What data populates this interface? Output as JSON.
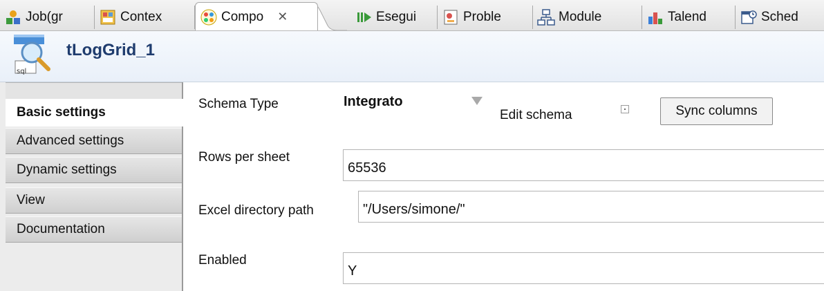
{
  "tabs": [
    {
      "label": "Job(gr",
      "icon": "job-icon",
      "active": false
    },
    {
      "label": "Contex",
      "icon": "context-icon",
      "active": false
    },
    {
      "label": "Compo",
      "icon": "component-icon",
      "active": true,
      "close": "✕"
    },
    {
      "label": "Esegui",
      "icon": "run-icon",
      "active": false
    },
    {
      "label": "Proble",
      "icon": "problems-icon",
      "active": false
    },
    {
      "label": "Module",
      "icon": "modules-icon",
      "active": false
    },
    {
      "label": "Talend",
      "icon": "talend-icon",
      "active": false
    },
    {
      "label": "Sched",
      "icon": "scheduler-icon",
      "active": false
    }
  ],
  "header": {
    "title": "tLogGrid_1",
    "icon": "tloggrid-component-icon"
  },
  "nav": {
    "items": [
      {
        "label": "Basic settings",
        "active": true
      },
      {
        "label": "Advanced settings",
        "active": false
      },
      {
        "label": "Dynamic settings",
        "active": false
      },
      {
        "label": "View",
        "active": false
      },
      {
        "label": "Documentation",
        "active": false
      }
    ]
  },
  "form": {
    "schema_type_label": "Schema Type",
    "schema_type_value": "Integrato",
    "edit_schema_label": "Edit schema",
    "sync_columns_label": "Sync columns",
    "rows_per_sheet_label": "Rows per sheet",
    "rows_per_sheet_value": "65536",
    "excel_dir_label": "Excel directory path",
    "excel_dir_value": "\"/Users/simone/\"",
    "enabled_label": "Enabled",
    "enabled_value": "Y"
  },
  "colors": {
    "header_title": "#1f3c6e",
    "header_bg": "#eef3fa",
    "nav_bg": "#ececec"
  }
}
